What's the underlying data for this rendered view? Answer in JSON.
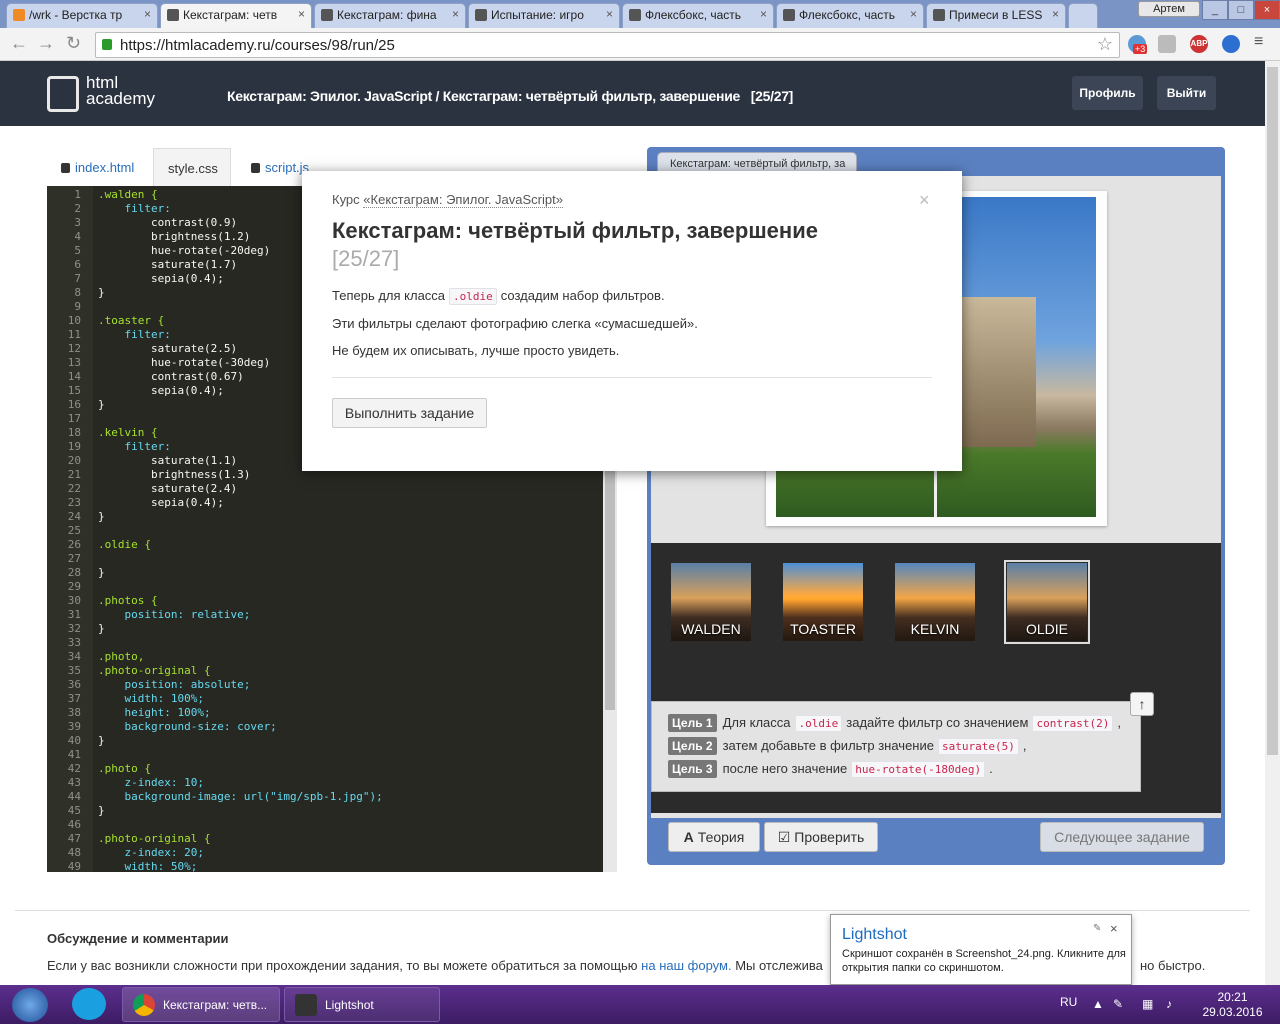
{
  "browser": {
    "tabs": [
      {
        "label": "/wrk - Верстка тр"
      },
      {
        "label": "Кекстаграм: четв"
      },
      {
        "label": "Кекстаграм: фина"
      },
      {
        "label": "Испытание: игро"
      },
      {
        "label": "Флексбокс, часть"
      },
      {
        "label": "Флексбокс, часть"
      },
      {
        "label": "Примеси в LESS"
      }
    ],
    "user": "Артем",
    "url": "https://htmlacademy.ru/courses/98/run/25",
    "ext_abp": "ABP",
    "ext_badge": "+3"
  },
  "site": {
    "logo_line1": "html",
    "logo_line2": "academy",
    "breadcrumb": "Кекстаграм: Эпилог. JavaScript / Кекстаграм: четвёртый фильтр, завершение",
    "breadcrumb_step": "[25/27]",
    "profile_btn": "Профиль",
    "logout_btn": "Выйти"
  },
  "editor": {
    "tabs": [
      {
        "label": "index.html"
      },
      {
        "label": "style.css"
      },
      {
        "label": "script.js"
      }
    ],
    "lines": [
      ".walden {",
      "    filter:",
      "        contrast(0.9)",
      "        brightness(1.2)",
      "        hue-rotate(-20deg)",
      "        saturate(1.7)",
      "        sepia(0.4);",
      "}",
      "",
      ".toaster {",
      "    filter:",
      "        saturate(2.5)",
      "        hue-rotate(-30deg)",
      "        contrast(0.67)",
      "        sepia(0.4);",
      "}",
      "",
      ".kelvin {",
      "    filter:",
      "        saturate(1.1)",
      "        brightness(1.3)",
      "        saturate(2.4)",
      "        sepia(0.4);",
      "}",
      "",
      ".oldie {",
      "",
      "}",
      "",
      ".photos {",
      "    position: relative;",
      "}",
      "",
      ".photo,",
      ".photo-original {",
      "    position: absolute;",
      "    width: 100%;",
      "    height: 100%;",
      "    background-size: cover;",
      "}",
      "",
      ".photo {",
      "    z-index: 10;",
      "    background-image: url(\"img/spb-1.jpg\");",
      "}",
      "",
      ".photo-original {",
      "    z-index: 20;",
      "    width: 50%;"
    ]
  },
  "preview": {
    "tab_label": "Кекстаграм: четвёртый фильтр, за",
    "filters": [
      {
        "label": "WALDEN"
      },
      {
        "label": "TOASTER"
      },
      {
        "label": "KELVIN"
      },
      {
        "label": "OLDIE"
      }
    ],
    "goals": [
      {
        "tag": "Цель 1",
        "text1": "Для класса",
        "code1": ".oldie",
        "text2": "задайте фильтр со значением",
        "code2": "contrast(2)",
        "text3": ","
      },
      {
        "tag": "Цель 2",
        "text1": "затем добавьте в фильтр значение",
        "code1": "saturate(5)",
        "text2": ","
      },
      {
        "tag": "Цель 3",
        "text1": "после него значение",
        "code1": "hue-rotate(-180deg)",
        "text2": "."
      }
    ],
    "theory_btn": "Теория",
    "check_btn": "Проверить",
    "next_btn": "Следующее задание"
  },
  "modal": {
    "course_prefix": "Курс",
    "course_name": "«Кекстаграм: Эпилог. JavaScript»",
    "title": "Кекстаграм: четвёртый фильтр, завершение",
    "step": "[25/27]",
    "p1_before": "Теперь для класса",
    "p1_code": ".oldie",
    "p1_after": "создадим набор фильтров.",
    "p2": "Эти фильтры сделают фотографию слегка «сумасшедшей».",
    "p3": "Не будем их описывать, лучше просто увидеть.",
    "button": "Выполнить задание",
    "close": "×"
  },
  "discussion": {
    "title": "Обсуждение и комментарии",
    "text_before": "Если у вас возникли сложности при прохождении задания, то вы можете обратиться за помощью",
    "link": "на наш форум.",
    "text_after": "Мы отслежива",
    "text_tail": "но быстро."
  },
  "lightshot": {
    "title": "Lightshot",
    "message": "Скриншот сохранён в Screenshot_24.png. Кликните для открытия папки со скриншотом.",
    "close": "×"
  },
  "taskbar": {
    "chrome_task": "Кекстаграм: четв...",
    "lightshot_task": "Lightshot",
    "lang": "RU",
    "time": "20:21",
    "date": "29.03.2016"
  },
  "colors": {
    "site_header": "#2b3240",
    "editor_bg": "#272822",
    "preview_frame": "#5b80c1",
    "taskbar": "#4a2576",
    "code_red": "#c7254e"
  }
}
